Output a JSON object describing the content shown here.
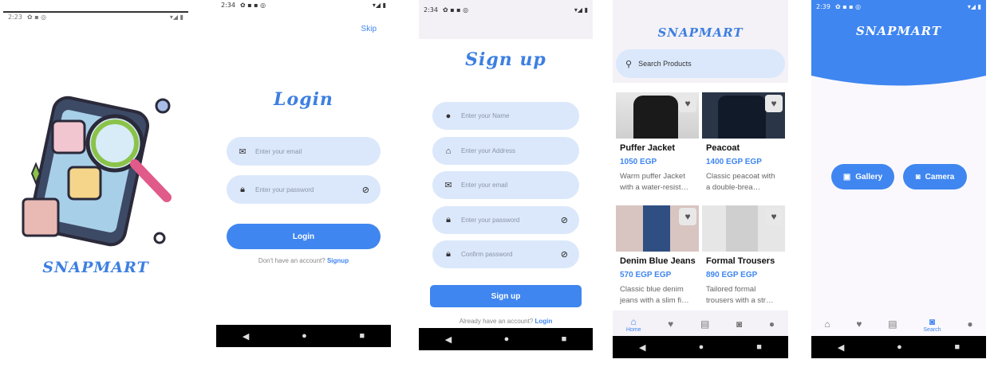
{
  "colors": {
    "accent": "#3f86f0",
    "field_bg": "#dbe8fb",
    "brand": "#3d7fe0"
  },
  "brand_name": "SNAPMART",
  "splash": {
    "time": "2:23",
    "signal": "▾◢ ▮"
  },
  "login": {
    "time": "2:34",
    "signal": "▾◢ ▮",
    "skip": "Skip",
    "title": "Login",
    "email_placeholder": "Enter your email",
    "password_placeholder": "Enter your password",
    "login_button": "Login",
    "no_account": "Don't have an account?",
    "signup_link": "Signup"
  },
  "signup": {
    "time": "2:34",
    "signal": "▾◢ ▮",
    "title": "Sign up",
    "name_placeholder": "Enter your Name",
    "address_placeholder": "Enter your Address",
    "email_placeholder": "Enter your email",
    "password_placeholder": "Enter your password",
    "confirm_placeholder": "Confirm password",
    "signup_button": "Sign up",
    "have_account": "Already have an account?",
    "login_link": "Login"
  },
  "home": {
    "search_placeholder": "Search Products",
    "products": [
      {
        "name": "Puffer Jacket",
        "price": "1050 EGP",
        "desc": "Warm puffer Jacket with a water-resist…",
        "icon": "heart-icon"
      },
      {
        "name": "Peacoat",
        "price": "1400 EGP EGP",
        "desc": "Classic peacoat with a double-brea…",
        "icon": "heart-icon"
      },
      {
        "name": "Denim Blue Jeans",
        "price": "570 EGP EGP",
        "desc": "Classic blue denim jeans with a slim fi…",
        "icon": "heart-icon"
      },
      {
        "name": "Formal Trousers",
        "price": "890 EGP EGP",
        "desc": "Tailored formal trousers with a str…",
        "icon": "heart-icon"
      }
    ],
    "tab_home": "Home"
  },
  "camera": {
    "time": "2:39",
    "signal": "▾◢ ▮",
    "gallery_button": "Gallery",
    "camera_button": "Camera",
    "tab_search": "Search"
  }
}
